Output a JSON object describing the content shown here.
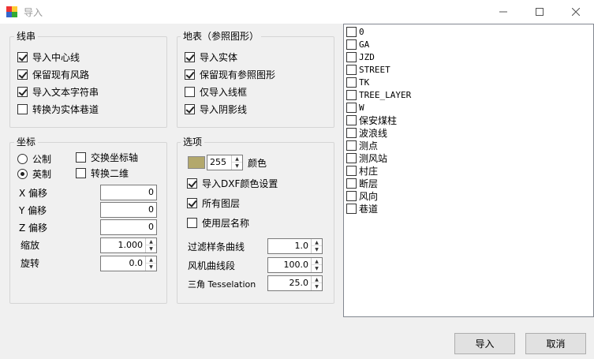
{
  "window": {
    "title": "导入",
    "icon": "app-icon"
  },
  "line_group": {
    "legend": "线串",
    "options": [
      {
        "label": "导入中心线",
        "checked": true
      },
      {
        "label": "保留现有风路",
        "checked": true
      },
      {
        "label": "导入文本字符串",
        "checked": true
      },
      {
        "label": "转换为实体巷道",
        "checked": false
      }
    ]
  },
  "surface_group": {
    "legend": "地表（参照图形）",
    "options": [
      {
        "label": "导入实体",
        "checked": true
      },
      {
        "label": "保留现有参照图形",
        "checked": true
      },
      {
        "label": "仅导入线框",
        "checked": false
      },
      {
        "label": "导入阴影线",
        "checked": true
      }
    ]
  },
  "coord_group": {
    "legend": "坐标",
    "radio_metric": "公制",
    "radio_imperial": "英制",
    "selected": "英制",
    "swap_axes": {
      "label": "交换坐标轴",
      "checked": false
    },
    "to_2d": {
      "label": "转换二维",
      "checked": false
    },
    "x_offset": {
      "label": "X 偏移",
      "value": "0"
    },
    "y_offset": {
      "label": "Y 偏移",
      "value": "0"
    },
    "z_offset": {
      "label": "Z 偏移",
      "value": "0"
    },
    "scale": {
      "label": "缩放",
      "value": "1.000"
    },
    "rotate": {
      "label": "旋转",
      "value": "0.0"
    }
  },
  "options_group": {
    "legend": "选项",
    "color_value": "255",
    "color_label": "颜色",
    "swatch_color": "#b3a86c",
    "import_dxf_color": {
      "label": "导入DXF颜色设置",
      "checked": true
    },
    "all_layers": {
      "label": "所有图层",
      "checked": true
    },
    "use_layer_name": {
      "label": "使用层名称",
      "checked": false
    },
    "filter_spline": {
      "label": "过滤样条曲线",
      "value": "1.0"
    },
    "fan_curve": {
      "label": "风机曲线段",
      "value": "100.0"
    },
    "triangle": {
      "label": "三角 Tesselation",
      "value": "25.0"
    }
  },
  "layers": [
    {
      "name": "0",
      "mono": true
    },
    {
      "name": "GA",
      "mono": true
    },
    {
      "name": "JZD",
      "mono": true
    },
    {
      "name": "STREET",
      "mono": true
    },
    {
      "name": "TK",
      "mono": true
    },
    {
      "name": "TREE_LAYER",
      "mono": true
    },
    {
      "name": "W",
      "mono": true
    },
    {
      "name": "保安煤柱",
      "mono": false
    },
    {
      "name": "波浪线",
      "mono": false
    },
    {
      "name": "测点",
      "mono": false
    },
    {
      "name": "测风站",
      "mono": false
    },
    {
      "name": "村庄",
      "mono": false
    },
    {
      "name": "断层",
      "mono": false
    },
    {
      "name": "风向",
      "mono": false
    },
    {
      "name": "巷道",
      "mono": false
    }
  ],
  "buttons": {
    "import": "导入",
    "cancel": "取消"
  }
}
